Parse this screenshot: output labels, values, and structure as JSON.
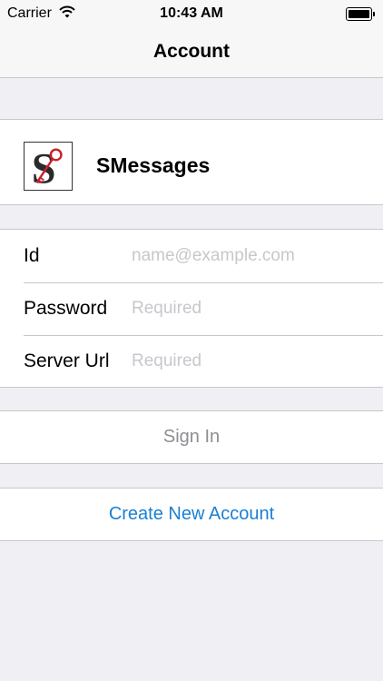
{
  "status_bar": {
    "carrier": "Carrier",
    "time": "10:43 AM",
    "wifi_icon": "wifi-icon",
    "battery_icon": "battery-icon"
  },
  "nav": {
    "title": "Account"
  },
  "app": {
    "name": "SMessages",
    "logo_icon": "smessages-logo-icon"
  },
  "form": {
    "id_label": "Id",
    "id_placeholder": "name@example.com",
    "id_value": "",
    "password_label": "Password",
    "password_placeholder": "Required",
    "password_value": "",
    "server_label": "Server Url",
    "server_placeholder": "Required",
    "server_value": ""
  },
  "actions": {
    "sign_in_label": "Sign In",
    "create_account_label": "Create New Account"
  },
  "colors": {
    "background": "#efeff4",
    "link": "#1a7fd4",
    "disabled": "#8e8e93",
    "placeholder": "#c7c7cd",
    "logo_red": "#c8202e"
  }
}
